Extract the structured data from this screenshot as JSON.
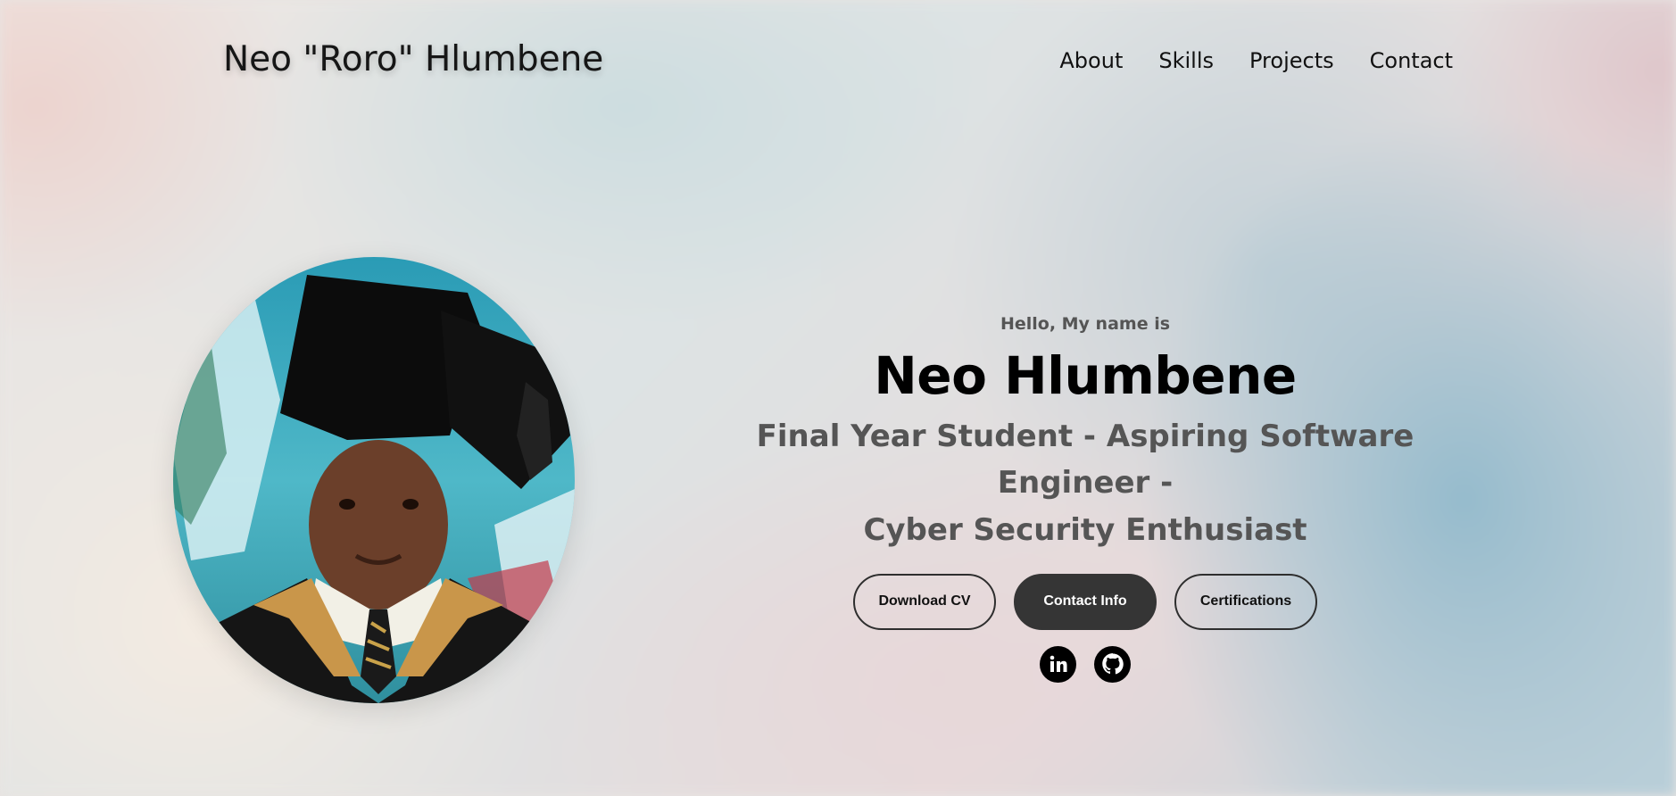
{
  "header": {
    "logo": "Neo \"Roro\" Hlumbene",
    "nav": [
      {
        "label": "About"
      },
      {
        "label": "Skills"
      },
      {
        "label": "Projects"
      },
      {
        "label": "Contact"
      }
    ]
  },
  "hero": {
    "greeting": "Hello, My name is",
    "name": "Neo Hlumbene",
    "tagline_line1": "Final Year Student - Aspiring Software Engineer -",
    "tagline_line2": "Cyber Security Enthusiast",
    "buttons": {
      "download_cv": "Download CV",
      "contact_info": "Contact Info",
      "certifications": "Certifications"
    },
    "socials": [
      {
        "icon": "linkedin-icon"
      },
      {
        "icon": "github-icon"
      }
    ]
  },
  "profile_photo": {
    "description": "profile picture"
  },
  "colors": {
    "text_primary": "#111111",
    "text_secondary": "#555555",
    "button_solid": "#353535",
    "button_border": "#2e2e2e"
  }
}
